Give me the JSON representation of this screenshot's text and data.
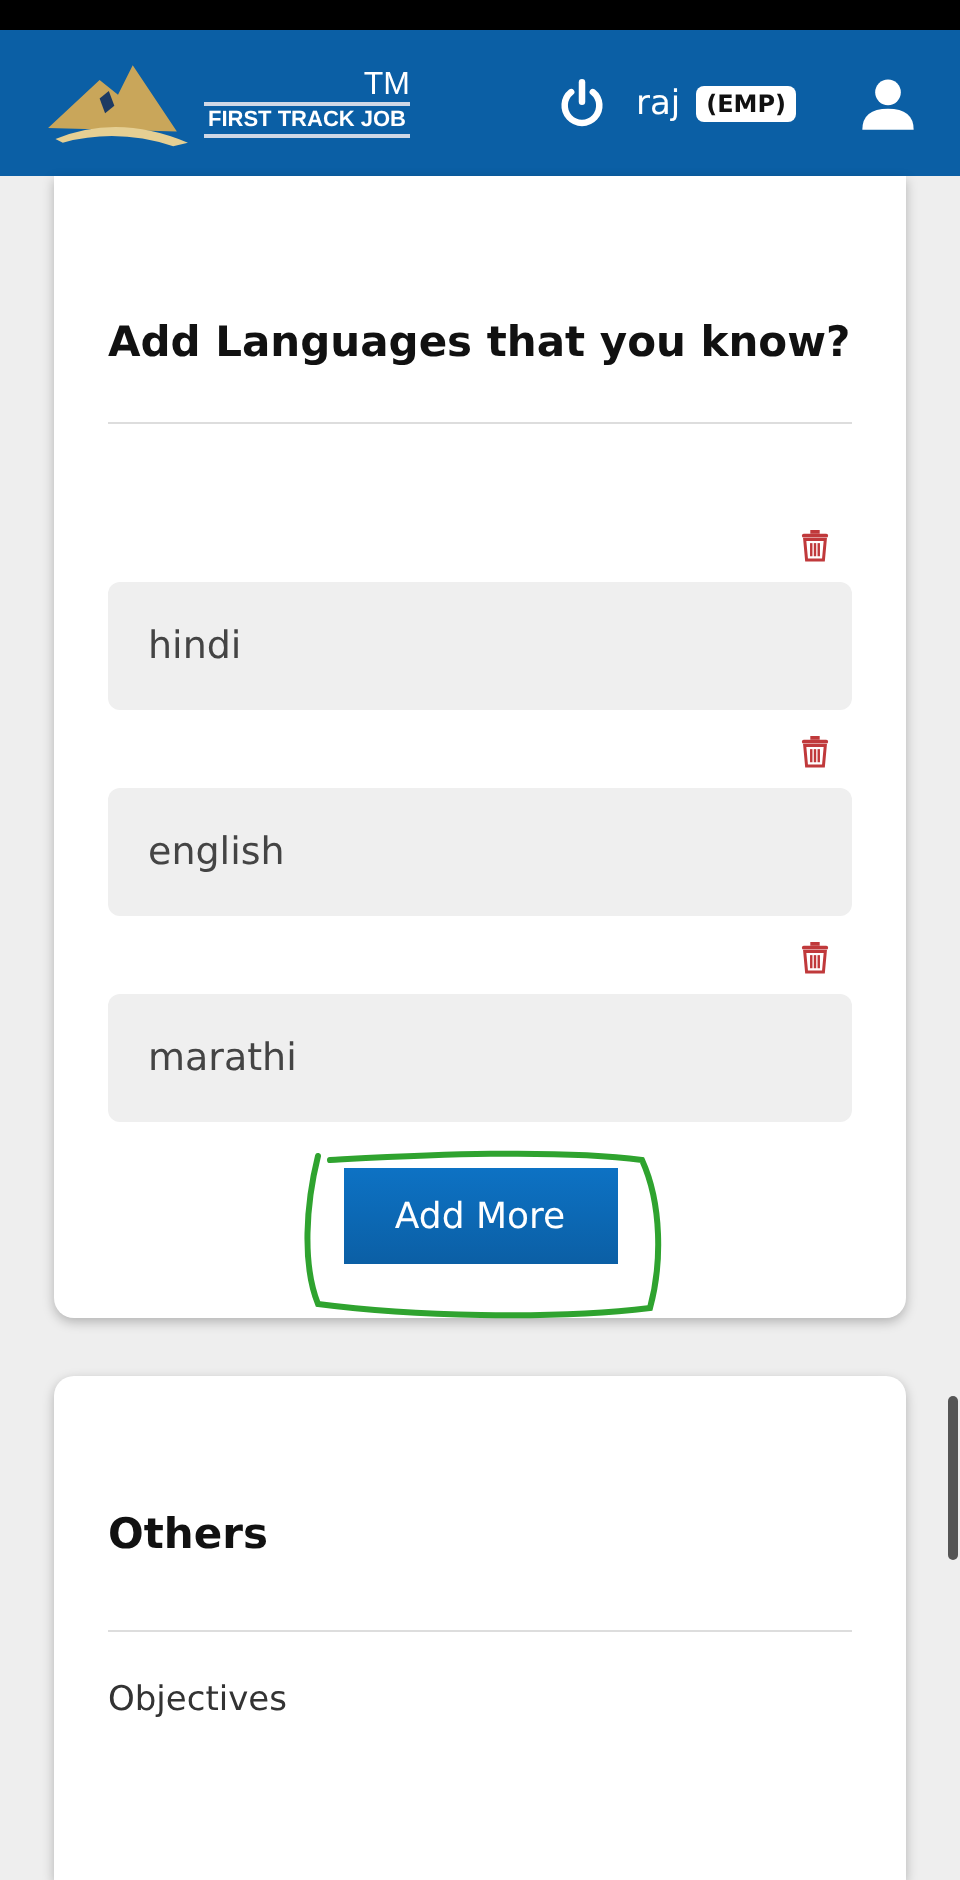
{
  "header": {
    "logo_tm": "TM",
    "logo_text": "FIRST TRACK JOB",
    "user": "raj",
    "role": "(EMP)"
  },
  "languages": {
    "title": "Add Languages that you know?",
    "entries": [
      {
        "value": "hindi"
      },
      {
        "value": "english"
      },
      {
        "value": "marathi"
      }
    ],
    "add_button": "Add More",
    "highlighted": true
  },
  "others": {
    "title": "Others",
    "items": [
      "Objectives"
    ]
  }
}
